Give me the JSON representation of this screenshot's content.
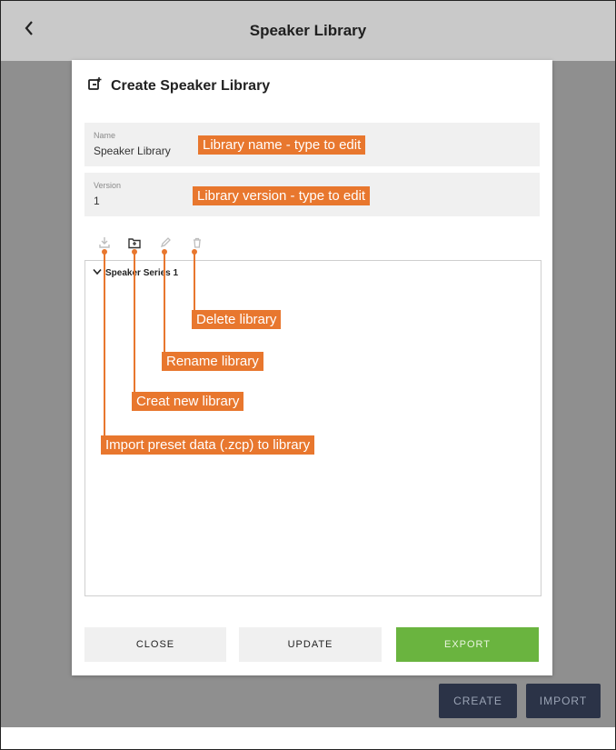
{
  "header": {
    "title": "Speaker Library",
    "back_glyph": "‹"
  },
  "background_buttons": {
    "create": "CREATE",
    "import": "IMPORT"
  },
  "modal": {
    "title": "Create Speaker Library",
    "name_field": {
      "label": "Name",
      "value": "Speaker Library"
    },
    "version_field": {
      "label": "Version",
      "value": "1"
    },
    "toolbar_icons": [
      "import-icon",
      "new-folder-icon",
      "rename-pencil-icon",
      "delete-trash-icon"
    ],
    "tree": {
      "item_label": "Speaker Series 1",
      "expanded": true
    },
    "footer": {
      "close": "CLOSE",
      "update": "UPDATE",
      "export": "EXPORT"
    }
  },
  "callouts": {
    "library_name": "Library name - type to edit",
    "library_version": "Library version - type to edit",
    "delete": "Delete library",
    "rename": "Rename library",
    "create": "Creat new library",
    "import": "Import preset data (.zcp) to library"
  },
  "colors": {
    "accent": "#e8772e",
    "export_green": "#6ab43f",
    "dark_button": "#2b3347"
  }
}
